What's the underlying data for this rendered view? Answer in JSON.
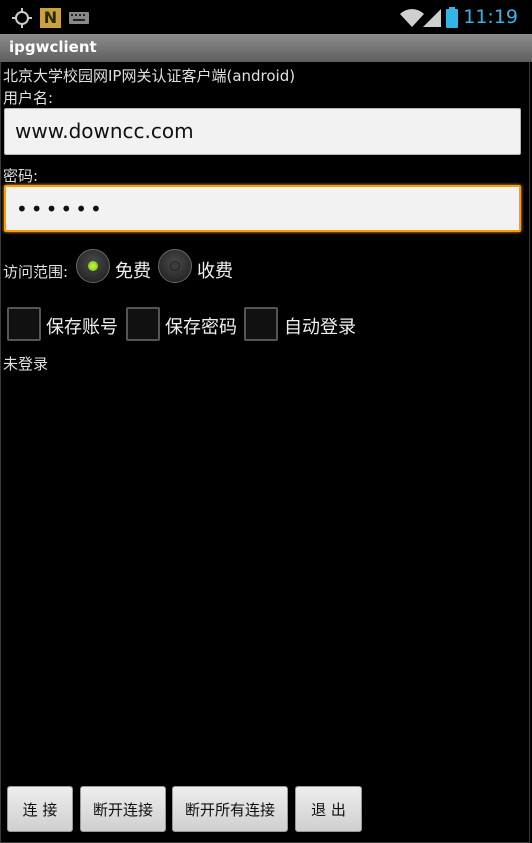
{
  "status_bar": {
    "time": "11:19",
    "icons": [
      "gps-icon",
      "app-n-icon",
      "keyboard-icon",
      "wifi-icon",
      "signal-icon",
      "battery-icon"
    ],
    "accent_color": "#33b5e5"
  },
  "app": {
    "title": "ipgwclient"
  },
  "header": {
    "subtitle": "北京大学校园网IP网关认证客户端(android)"
  },
  "form": {
    "username_label": "用户名:",
    "username_value": "www.downcc.com",
    "password_label": "密码:",
    "password_value": "••••••",
    "scope_label": "访问范围:",
    "scope_options": [
      {
        "label": "免费",
        "selected": true
      },
      {
        "label": "收费",
        "selected": false
      }
    ],
    "checkboxes": [
      {
        "label": "保存账号",
        "checked": false
      },
      {
        "label": "保存密码",
        "checked": false
      },
      {
        "label": "自动登录",
        "checked": false
      }
    ],
    "status_text": "未登录"
  },
  "buttons": {
    "connect": "连 接",
    "disconnect": "断开连接",
    "disconnect_all": "断开所有连接",
    "exit": "退 出"
  }
}
